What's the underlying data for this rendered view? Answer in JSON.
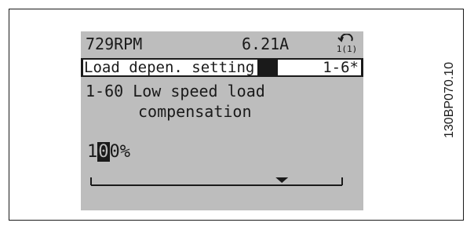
{
  "status_line": {
    "speed": "729RPM",
    "current": "6.21A",
    "setup_indicator": "1(1)"
  },
  "menu": {
    "group_title": "Load depen. setting",
    "group_index": "1-6*"
  },
  "parameter": {
    "line1": "1-60 Low speed load",
    "line2": "compensation"
  },
  "value": {
    "before_cursor": "1",
    "cursor_digit": "0",
    "after_cursor": "0",
    "unit": "%",
    "range_position": 0.76
  },
  "figure_code": "130BP070.10",
  "colors": {
    "lcd_background": "#bdbdbd",
    "lcd_foreground": "#1a1a1a"
  },
  "icons": {
    "status_icon": "hand-return-icon",
    "range_marker": "triangle-down-icon"
  }
}
